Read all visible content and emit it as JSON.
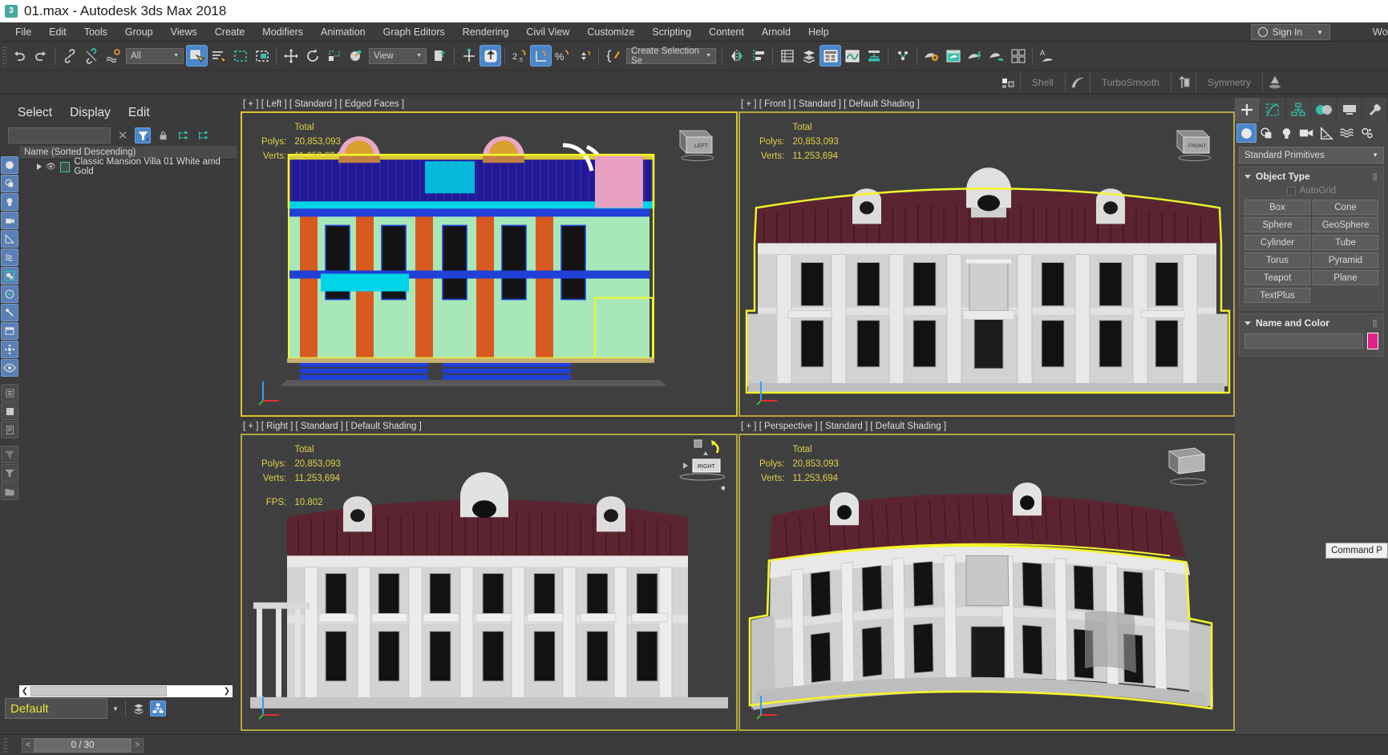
{
  "titlebar": {
    "icon": "3dsmax-app-icon",
    "title": "01.max - Autodesk 3ds Max 2018"
  },
  "menubar": {
    "items": [
      "File",
      "Edit",
      "Tools",
      "Group",
      "Views",
      "Create",
      "Modifiers",
      "Animation",
      "Graph Editors",
      "Rendering",
      "Civil View",
      "Customize",
      "Scripting",
      "Content",
      "Arnold",
      "Help"
    ],
    "signin_label": "Sign In",
    "wordmark": "Wo"
  },
  "toolbar": {
    "selection_filter": "All",
    "reference_coord": "View",
    "selection_set": "Create Selection Se",
    "icons_row1": [
      "undo-icon",
      "redo-icon",
      "select-link-icon",
      "unlink-icon",
      "bind-spacewarp-icon",
      "select-object-icon",
      "select-by-name-icon",
      "rect-select-region-icon",
      "window-crossing-icon",
      "select-move-icon",
      "select-rotate-icon",
      "select-scale-icon",
      "placement-icon",
      "use-center-flyout-icon",
      "select-manipulate-icon",
      "snaps-toggle-icon",
      "angle-snap-icon",
      "percent-snap-icon",
      "spinner-snap-icon",
      "edit-named-sets-icon",
      "mirror-icon",
      "align-icon",
      "layer-explorer-icon",
      "scene-explorer-icon",
      "ribbon-toggle-icon",
      "curve-editor-icon",
      "schematic-view-icon",
      "material-editor-icon",
      "render-setup-icon",
      "render-frame-icon",
      "render-production-icon",
      "render-iterative-icon",
      "active-shade-icon",
      "render-grid-icon",
      "render-to-texture-icon"
    ]
  },
  "modifier_ribbon": {
    "items": [
      {
        "label": "Shell",
        "icon": "shell-icon"
      },
      {
        "label": "TurboSmooth",
        "icon": "turbosmooth-icon"
      },
      {
        "label": "Symmetry",
        "icon": "symmetry-icon"
      }
    ]
  },
  "explorer": {
    "menu": [
      "Select",
      "Display",
      "Edit"
    ],
    "search_value": "",
    "clear_icon": "close-x-icon",
    "filter_icon": "filter-icon",
    "lock_icon": "lock-icon",
    "expand_icon": "expand-all-icon",
    "collapse_icon": "collapse-all-icon",
    "column_header": "Name (Sorted Descending)",
    "rows": [
      {
        "name": "Classic Mansion Villa 01 White amd Gold",
        "expander": "triangle-right-icon",
        "visibility": "eye-icon",
        "type": "geometry-icon"
      }
    ],
    "left_icons": [
      "geometry-filter-icon",
      "shapes-filter-icon",
      "lights-filter-icon",
      "cameras-filter-icon",
      "helpers-filter-icon",
      "spacewarps-filter-icon",
      "groups-filter-icon",
      "xrefs-filter-icon",
      "bones-filter-icon",
      "containers-filter-icon",
      "particles-filter-icon",
      "visibility-filter-icon",
      "layer-list-icon",
      "object-color-icon",
      "properties-icon",
      "sort-filter-icon",
      "funnel-icon",
      "folder-icon"
    ]
  },
  "layer_bar": {
    "layer_name": "Default",
    "layers_icon": "layers-icon",
    "explorer_icon": "scene-explorer-icon"
  },
  "viewports": [
    {
      "id": "left",
      "label": "[ + ] [ Left ] [ Standard ] [ Edged Faces ]",
      "stats_title": "Total",
      "polys_label": "Polys:",
      "polys": "20,853,093",
      "verts_label": "Verts:",
      "verts": "11,253,694",
      "fps_label": "",
      "fps": "",
      "cube_label": "LEFT",
      "active": true,
      "shading": "wireframe-edged-faces"
    },
    {
      "id": "front",
      "label": "[ + ] [ Front ] [ Standard ] [ Default Shading ]",
      "stats_title": "Total",
      "polys_label": "Polys:",
      "polys": "20,853,093",
      "verts_label": "Verts:",
      "verts": "11,253,694",
      "fps_label": "",
      "fps": "",
      "cube_label": "FRONT",
      "active": false,
      "shading": "shaded"
    },
    {
      "id": "right",
      "label": "[ + ] [ Right ] [ Standard ] [ Default Shading ]",
      "stats_title": "Total",
      "polys_label": "Polys:",
      "polys": "20,853,093",
      "verts_label": "Verts:",
      "verts": "11,253,694",
      "fps_label": "FPS:",
      "fps": "10.802",
      "cube_label": "RIGHT",
      "active": false,
      "shading": "shaded"
    },
    {
      "id": "perspective",
      "label": "[ + ] [ Perspective ] [ Standard ] [ Default Shading ]",
      "stats_title": "Total",
      "polys_label": "Polys:",
      "polys": "20,853,093",
      "verts_label": "Verts:",
      "verts": "11,253,694",
      "fps_label": "",
      "fps": "",
      "cube_label": "",
      "active": false,
      "shading": "shaded"
    }
  ],
  "command_panel": {
    "tabs": [
      "create-tab-icon",
      "modify-tab-icon",
      "hierarchy-tab-icon",
      "motion-tab-icon",
      "display-tab-icon",
      "utilities-tab-icon"
    ],
    "subtabs": [
      "geometry-icon",
      "shapes-icon",
      "lights-icon",
      "cameras-icon",
      "helpers-icon",
      "spacewarps-icon",
      "systems-icon"
    ],
    "category": "Standard Primitives",
    "object_type": {
      "title": "Object Type",
      "autogrid_label": "AutoGrid",
      "buttons": [
        "Box",
        "Cone",
        "Sphere",
        "GeoSphere",
        "Cylinder",
        "Tube",
        "Torus",
        "Pyramid",
        "Teapot",
        "Plane",
        "TextPlus"
      ]
    },
    "name_and_color": {
      "title": "Name and Color",
      "name_value": "",
      "color": "#e0218a"
    },
    "tooltip": "Command P"
  },
  "timeline": {
    "frame_display": "0 / 30",
    "prev_icon": "prev-frame-icon",
    "next_icon": "next-frame-icon"
  },
  "colors": {
    "accent_blue": "#4a86c8",
    "viewport_border_active": "#d8c832",
    "stats_yellow": "#e0d24a",
    "panel_bg": "#3b3b3b",
    "roof_maroon": "#5c2430",
    "selection_highlight": "#f5f52a"
  }
}
